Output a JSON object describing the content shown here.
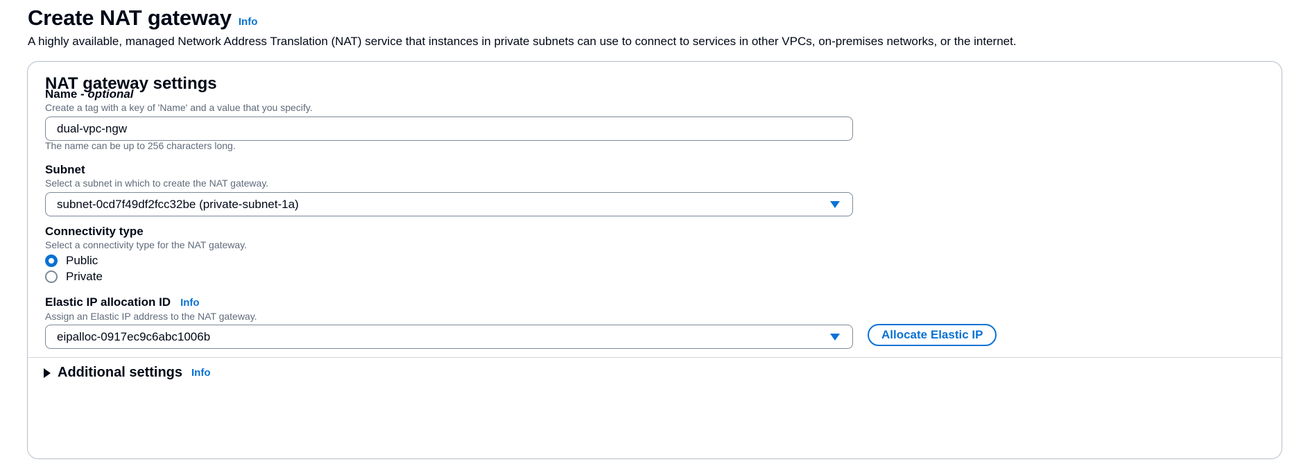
{
  "header": {
    "title": "Create NAT gateway",
    "info": "Info",
    "description": "A highly available, managed Network Address Translation (NAT) service that instances in private subnets can use to connect to services in other VPCs, on-premises networks, or the internet."
  },
  "panel": {
    "title": "NAT gateway settings",
    "name_field": {
      "label": "Name - ",
      "label_optional": "optional",
      "description": "Create a tag with a key of 'Name' and a value that you specify.",
      "value": "dual-vpc-ngw",
      "hint": "The name can be up to 256 characters long."
    },
    "subnet_field": {
      "label": "Subnet",
      "description": "Select a subnet in which to create the NAT gateway.",
      "selected": "subnet-0cd7f49df2fcc32be (private-subnet-1a)"
    },
    "connectivity_field": {
      "label": "Connectivity type",
      "description": "Select a connectivity type for the NAT gateway.",
      "options": [
        {
          "label": "Public",
          "checked": true
        },
        {
          "label": "Private",
          "checked": false
        }
      ]
    },
    "eip_field": {
      "label": "Elastic IP allocation ID",
      "info": "Info",
      "description": "Assign an Elastic IP address to the NAT gateway.",
      "selected": "eipalloc-0917ec9c6abc1006b",
      "allocate_button": "Allocate Elastic IP"
    },
    "additional": {
      "label": "Additional settings",
      "info": "Info"
    }
  },
  "colors": {
    "accent": "#0972d3",
    "text": "#000716",
    "secondary_text": "#5f6b7a",
    "border": "#7d8998"
  }
}
